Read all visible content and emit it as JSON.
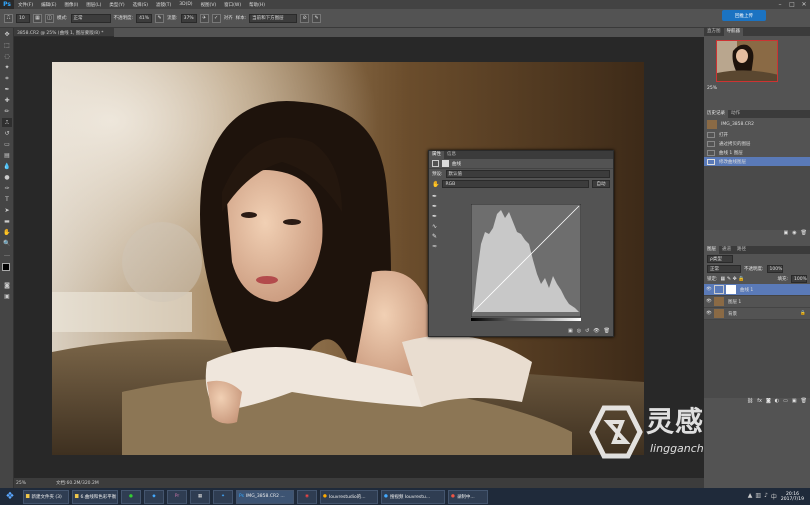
{
  "app": {
    "logo": "Ps",
    "window_buttons": [
      "–",
      "□",
      "✕"
    ]
  },
  "menu": [
    "文件(F)",
    "编辑(E)",
    "图像(I)",
    "图层(L)",
    "类型(Y)",
    "选择(S)",
    "滤镜(T)",
    "3D(D)",
    "视图(V)",
    "窗口(W)",
    "帮助(H)"
  ],
  "options": {
    "brush_size": "10",
    "mode_label": "模式:",
    "mode_value": "正常",
    "opacity_label": "不透明度:",
    "opacity_value": "41%",
    "flow_label": "流量:",
    "flow_value": "37%",
    "align_label": "对齐",
    "sample_label": "样本:",
    "sample_value": "当前和下方图层"
  },
  "cloud_button": "回推上传",
  "document_tab": "3858.CR2 @ 25% (曲线 1, 图层蒙版/8) *",
  "status": {
    "zoom": "25%",
    "doc_size": "文档:60.2M/320.2M"
  },
  "navigator": {
    "tabs": [
      "直方图",
      "导航器"
    ],
    "zoom": "25%"
  },
  "history": {
    "tabs": [
      "历史记录",
      "动作"
    ],
    "snapshot": "IMG_3858.CR2",
    "items": [
      "打开",
      "通过拷贝的图层",
      "曲线 1 图层",
      "修改曲线图层"
    ]
  },
  "properties": {
    "tabs": [
      "属性",
      "信息"
    ],
    "panel_title": "曲线",
    "preset_label": "预设:",
    "preset_value": "默认值",
    "channel_value": "RGB",
    "auto_button": "自动"
  },
  "layers": {
    "tabs": [
      "图层",
      "通道",
      "路径"
    ],
    "kind_label": "ρ类型",
    "blend_mode": "正常",
    "opacity_label": "不透明度:",
    "opacity_value": "100%",
    "lock_label": "锁定:",
    "fill_label": "填充:",
    "fill_value": "100%",
    "rows": [
      {
        "name": "曲线 1",
        "type": "adjustment"
      },
      {
        "name": "图层 1",
        "type": "pixel"
      },
      {
        "name": "背景",
        "type": "background"
      }
    ]
  },
  "taskbar": {
    "items": [
      "新建文件夹 (3)",
      "6.曲线和色彩平衡",
      "",
      "",
      "",
      "",
      "IMG_3858.CR2 ...",
      "",
      "louvrestudio的...",
      "搜视频 louvrestu...",
      "录制中..."
    ],
    "clock_time": "20:16",
    "clock_date": "2017/7/19"
  },
  "watermark": {
    "name": "灵感中国",
    "url": "lingganchina.com"
  },
  "colors": {
    "accent": "#1b73c2",
    "selected_layer": "#5a7ab8",
    "watermark": "#ffffff"
  }
}
